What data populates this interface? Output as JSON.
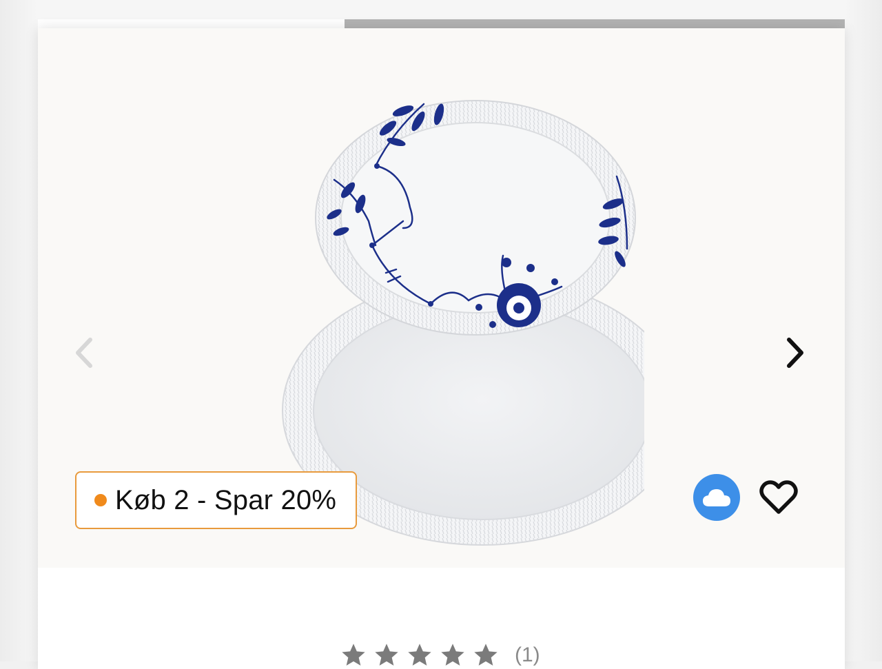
{
  "gallery": {
    "image_alt": "Blue Fluted Mega ovale fade",
    "progress_fraction": 0.62,
    "prev_label": "Forrige",
    "next_label": "Næste"
  },
  "promo": {
    "text": "Køb 2 - Spar 20%"
  },
  "actions": {
    "cloud_icon": "cloud-icon",
    "favorite_icon": "heart-outline-icon"
  },
  "rating": {
    "stars": 5,
    "count_text": "(1)"
  },
  "colors": {
    "promo_border": "#e89a3c",
    "promo_dot": "#f08a1c",
    "cloud_button": "#3d8fe8",
    "pattern_blue": "#1c2f8a",
    "star": "#7b7b7b"
  }
}
